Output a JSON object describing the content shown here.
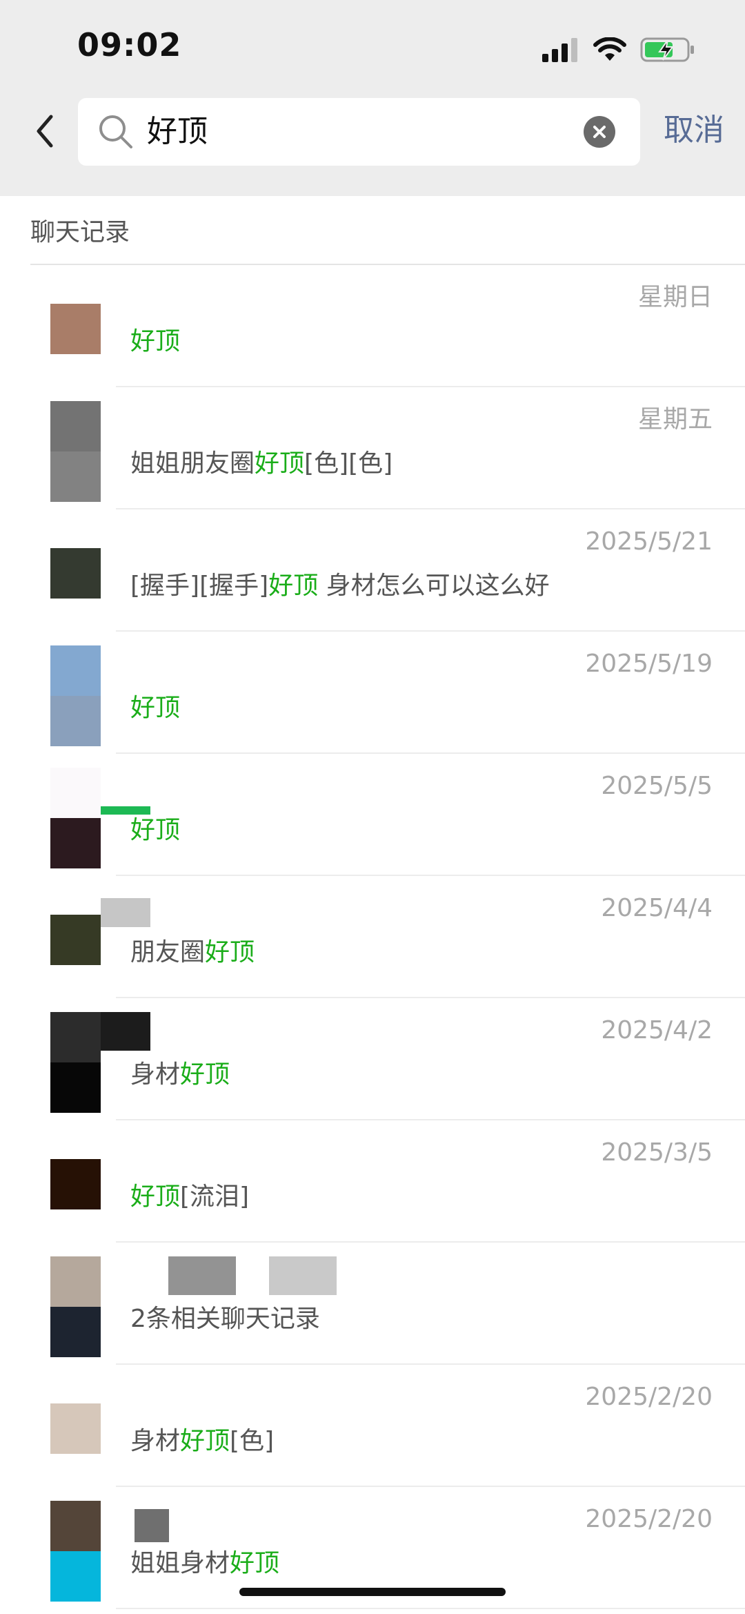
{
  "status_bar": {
    "time": "09:02"
  },
  "search": {
    "query": "好顶",
    "cancel_label": "取消"
  },
  "section": {
    "title": "聊天记录"
  },
  "results": [
    {
      "date": "星期日",
      "segments": [
        [
          "好顶",
          true
        ]
      ]
    },
    {
      "date": "星期五",
      "segments": [
        [
          "姐姐朋友圈",
          false
        ],
        [
          "好顶",
          true
        ],
        [
          "[色][色]",
          false
        ]
      ]
    },
    {
      "date": "2025/5/21",
      "segments": [
        [
          "[握手][握手]",
          false
        ],
        [
          "好顶",
          true
        ],
        [
          " 身材怎么可以这么好",
          false
        ]
      ]
    },
    {
      "date": "2025/5/19",
      "segments": [
        [
          "好顶",
          true
        ]
      ]
    },
    {
      "date": "2025/5/5",
      "segments": [
        [
          "好顶",
          true
        ]
      ]
    },
    {
      "date": "2025/4/4",
      "segments": [
        [
          "朋友圈",
          false
        ],
        [
          "好顶",
          true
        ]
      ]
    },
    {
      "date": "2025/4/2",
      "segments": [
        [
          "身材",
          false
        ],
        [
          "好顶",
          true
        ]
      ]
    },
    {
      "date": "2025/3/5",
      "segments": [
        [
          "好顶",
          true
        ],
        [
          "[流泪]",
          false
        ]
      ]
    },
    {
      "date": "",
      "segments": [
        [
          "2条相关聊天记录",
          false
        ]
      ]
    },
    {
      "date": "2025/2/20",
      "segments": [
        [
          "身材",
          false
        ],
        [
          "好顶",
          true
        ],
        [
          "[色]",
          false
        ]
      ]
    },
    {
      "date": "2025/2/20",
      "segments": [
        [
          "姐姐身材",
          false
        ],
        [
          "好顶",
          true
        ]
      ]
    }
  ],
  "colors": {
    "highlight": "#1aad19",
    "link": "#576b95",
    "date": "#a8a8a8"
  }
}
